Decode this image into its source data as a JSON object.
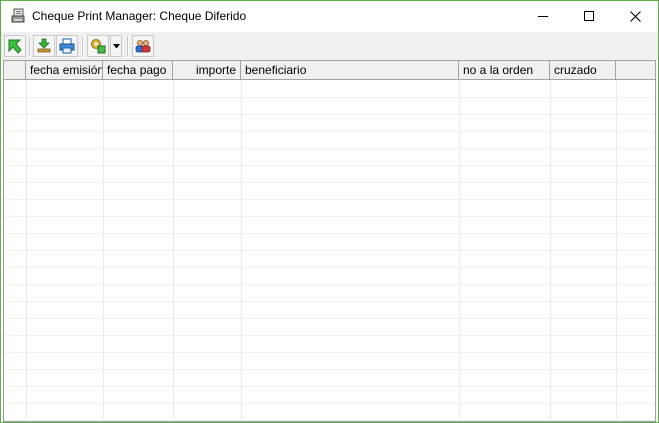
{
  "window": {
    "title": "Cheque Print Manager: Cheque Diferido",
    "icons": {
      "app": "printer-document-icon",
      "minimize": "minimize-icon",
      "maximize": "maximize-icon",
      "close": "close-icon"
    }
  },
  "toolbar": {
    "buttons": [
      {
        "id": "exit",
        "icon": "green-arrow-exit-icon"
      },
      {
        "id": "download",
        "icon": "download-icon"
      },
      {
        "id": "print",
        "icon": "printer-icon"
      },
      {
        "id": "tools",
        "icon": "gear-puzzle-icon",
        "has_dropdown": true
      },
      {
        "id": "users",
        "icon": "users-icon"
      }
    ]
  },
  "grid": {
    "columns": [
      {
        "label": "",
        "align": "left"
      },
      {
        "label": "fecha emisión",
        "align": "left"
      },
      {
        "label": "fecha pago",
        "align": "left"
      },
      {
        "label": "importe",
        "align": "right"
      },
      {
        "label": "beneficiario",
        "align": "left"
      },
      {
        "label": "no a la orden",
        "align": "left"
      },
      {
        "label": "cruzado",
        "align": "left"
      },
      {
        "label": "",
        "align": "left"
      }
    ],
    "rows": []
  }
}
